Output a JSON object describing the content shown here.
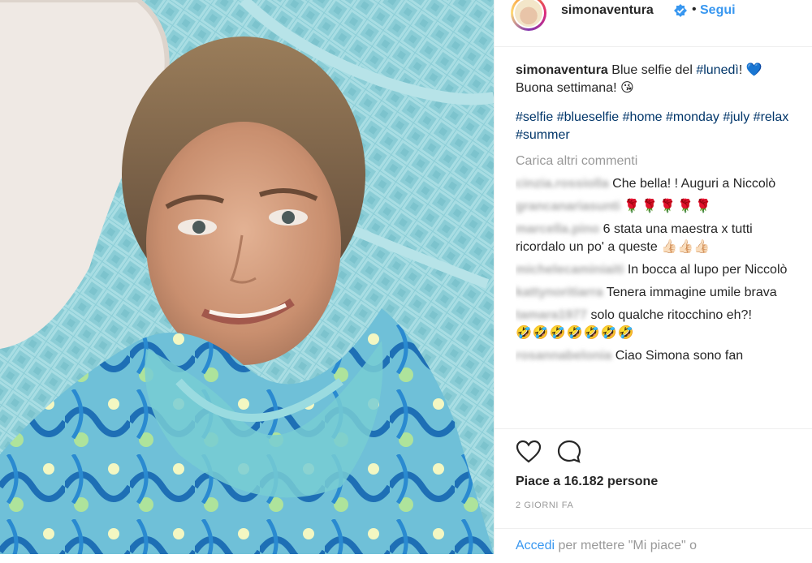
{
  "post": {
    "username": "simonaventura",
    "follow_label": "Segui",
    "separator": "•"
  },
  "caption": {
    "username": "simonaventura",
    "text_before": "Blue selfie del ",
    "tag_day": "#lunedì",
    "heart": "💙",
    "line2": "Buona settimana! 😘"
  },
  "hashtags": [
    "#selfie",
    "#blueselfie",
    "#home",
    "#monday",
    "#july",
    "#relax",
    "#summer"
  ],
  "load_more_label": "Carica altri commenti",
  "comments": [
    {
      "user": "cinzia.rossiolla",
      "text": "Che bella! ! Auguri a Niccolò",
      "emoji": ""
    },
    {
      "user": "grancanariasunti",
      "text": "",
      "emoji": "🌹🌹🌹🌹🌹"
    },
    {
      "user": "marcella.pino",
      "text": "6 stata una maestra x tutti ricordalo un po' a queste",
      "emoji": "👍🏻👍🏻👍🏻"
    },
    {
      "user": "michelecaminiaiti",
      "text": "In bocca al lupo per Niccolò",
      "emoji": ""
    },
    {
      "user": "kattynoritiarra",
      "text": "Tenera immagine umile brava",
      "emoji": ""
    },
    {
      "user": "tamara1977",
      "text": "solo qualche ritocchino eh?!",
      "emoji": "🤣🤣🤣🤣🤣🤣🤣"
    },
    {
      "user": "rosannabelonia",
      "text": "Ciao Simona sono fan",
      "emoji": ""
    }
  ],
  "actions": {
    "likes_text": "Piace a 16.182 persone",
    "time_text": "2 GIORNI FA"
  },
  "login": {
    "link_text": "Accedi",
    "rest_text": " per mettere \"Mi piace\" o"
  },
  "colors": {
    "link_blue": "#3897f0",
    "hashtag_blue": "#003569",
    "muted": "#999999",
    "text": "#262626"
  },
  "icons": {
    "heart": "heart-outline-icon",
    "comment": "comment-bubble-icon",
    "verified": "verified-badge-icon"
  }
}
